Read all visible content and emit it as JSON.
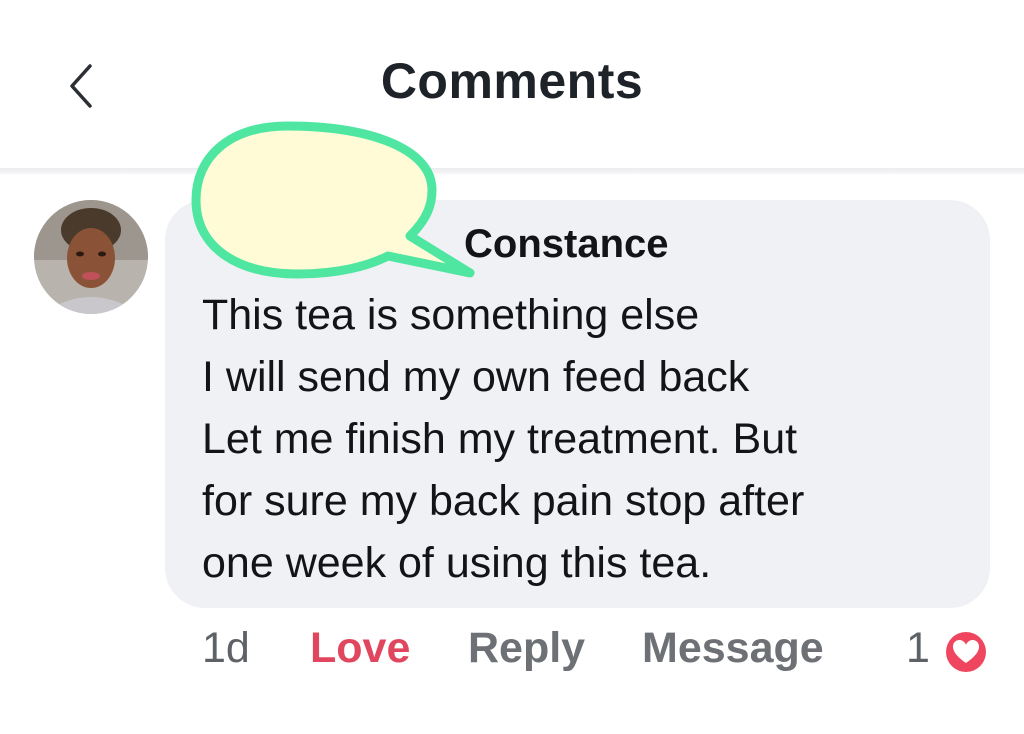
{
  "header": {
    "title": "Comments",
    "back_icon": "chevron-left-icon"
  },
  "comment": {
    "author_visible": "Constance",
    "lines": [
      "This tea is something else",
      "I will send my own feed back",
      "Let me finish my treatment. But",
      "for sure my back pain stop after",
      "one week of using this tea."
    ],
    "time": "1d",
    "actions": {
      "love": "Love",
      "reply": "Reply",
      "message": "Message"
    },
    "reaction_count": "1",
    "reaction_icon": "heart-reaction-icon"
  },
  "colors": {
    "love_accent": "#e0475f",
    "bubble_bg": "#f0f1f5",
    "redaction_fill": "#fffbd6",
    "redaction_stroke": "#4ee6a0"
  }
}
